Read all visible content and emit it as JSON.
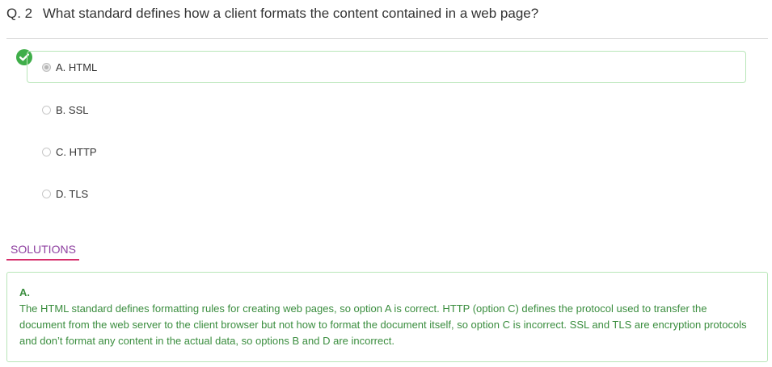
{
  "question": {
    "number": "Q. 2",
    "text": "What standard defines how a client formats the content contained in a web page?"
  },
  "options": [
    {
      "label": "A. HTML",
      "selected": true,
      "correct": true
    },
    {
      "label": "B. SSL",
      "selected": false,
      "correct": false
    },
    {
      "label": "C. HTTP",
      "selected": false,
      "correct": false
    },
    {
      "label": "D. TLS",
      "selected": false,
      "correct": false
    }
  ],
  "correct_indicator_icon": "check-circle-icon",
  "solutions": {
    "tab_label": "SOLUTIONS",
    "answer": "A.",
    "explanation": "The HTML standard defines formatting rules for creating web pages, so option A is correct. HTTP (option C) defines the protocol used to transfer the document from the web server to the client browser but not how to format the document itself, so option C is incorrect. SSL and TLS are encryption protocols and don’t format any content in the actual data, so options B and D are incorrect."
  },
  "colors": {
    "correct_green": "#3fae49",
    "solution_text": "#3a8d3e",
    "solutions_tab_text": "#8e3fa0",
    "solutions_tab_underline": "#d62e6b",
    "border_green": "#b8e6b8"
  }
}
